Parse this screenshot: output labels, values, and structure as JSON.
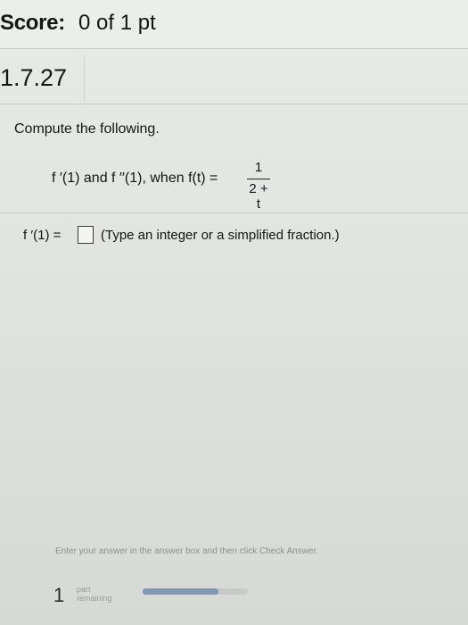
{
  "header": {
    "score_label": "Score:",
    "score_value": "0 of 1 pt"
  },
  "question": {
    "id": "1.7.27",
    "prompt": "Compute the following.",
    "problem_text": "f ′(1) and f ′′(1), when f(t) =",
    "fraction_numerator": "1",
    "fraction_denominator": "2 + t",
    "answer_label": "f ′(1) =",
    "answer_value": "",
    "answer_hint": "(Type an integer or a simplified fraction.)"
  },
  "footer": {
    "instruction": "Enter your answer in the answer box and then click Check Answer.",
    "parts_count": "1",
    "parts_label_1": "part",
    "parts_label_2": "remaining",
    "progress_fraction": 0.72
  }
}
